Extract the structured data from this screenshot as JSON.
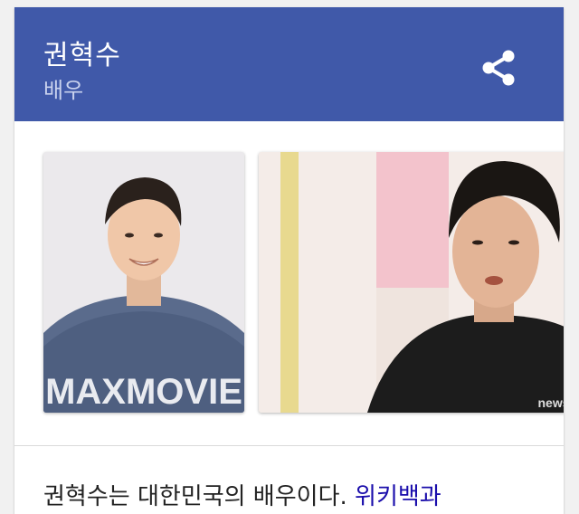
{
  "header": {
    "title": "권혁수",
    "subtitle": "배우",
    "share_icon": "share-icon",
    "bg_color": "#4059a9"
  },
  "gallery": {
    "photos": [
      {
        "watermark": "MAXMOVIE"
      },
      {
        "watermark": "news"
      }
    ]
  },
  "description": {
    "text": "권혁수는 대한민국의 배우이다. ",
    "source_link": "위키백과",
    "link_color": "#1a0dab"
  }
}
